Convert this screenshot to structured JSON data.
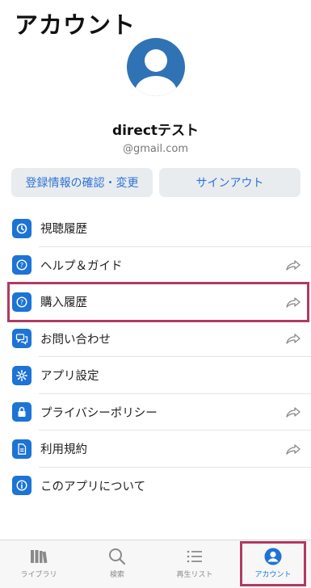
{
  "header": {
    "title": "アカウント"
  },
  "profile": {
    "name": "directテスト",
    "email": "@gmail.com"
  },
  "actions": {
    "edit_label": "登録情報の確認・変更",
    "signout_label": "サインアウト"
  },
  "menu": {
    "items": [
      {
        "label": "視聴履歴",
        "icon": "history-icon"
      },
      {
        "label": "ヘルプ＆ガイド",
        "icon": "help-icon"
      },
      {
        "label": "購入履歴",
        "icon": "purchase-history-icon"
      },
      {
        "label": "お問い合わせ",
        "icon": "chat-icon"
      },
      {
        "label": "アプリ設定",
        "icon": "gear-icon"
      },
      {
        "label": "プライバシーポリシー",
        "icon": "lock-icon"
      },
      {
        "label": "利用規約",
        "icon": "document-icon"
      },
      {
        "label": "このアプリについて",
        "icon": "info-icon"
      }
    ]
  },
  "tabs": [
    {
      "label": "ライブラリ",
      "icon": "library-icon"
    },
    {
      "label": "検索",
      "icon": "search-icon"
    },
    {
      "label": "再生リスト",
      "icon": "playlist-icon"
    },
    {
      "label": "アカウント",
      "icon": "account-icon"
    }
  ],
  "colors": {
    "accent": "#1d73d6",
    "avatar": "#2f73b5",
    "highlight": "#b13a62",
    "button_bg": "#e8ecef"
  }
}
